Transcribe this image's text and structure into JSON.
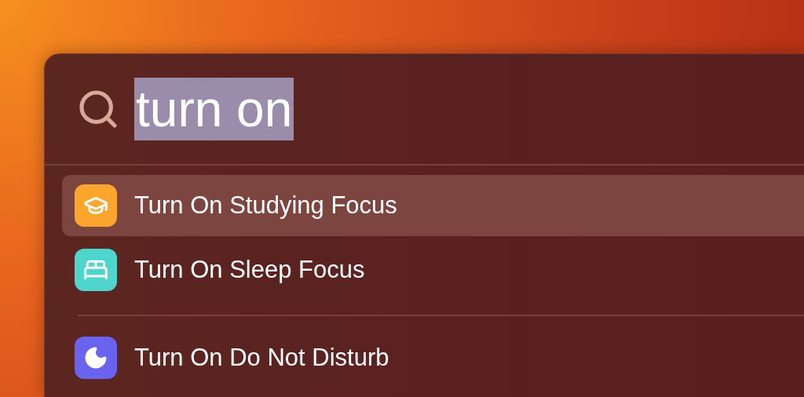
{
  "search": {
    "value": "turn on",
    "selected": true
  },
  "groups": [
    {
      "items": [
        {
          "kind": "studying",
          "color": "#fba52c",
          "label": "Turn On Studying Focus",
          "selected": true
        },
        {
          "kind": "sleep",
          "color": "#4fd6cc",
          "label": "Turn On Sleep Focus",
          "selected": false
        }
      ]
    },
    {
      "items": [
        {
          "kind": "dnd",
          "color": "#6a63ef",
          "label": "Turn On Do Not Disturb",
          "selected": false
        }
      ]
    }
  ]
}
